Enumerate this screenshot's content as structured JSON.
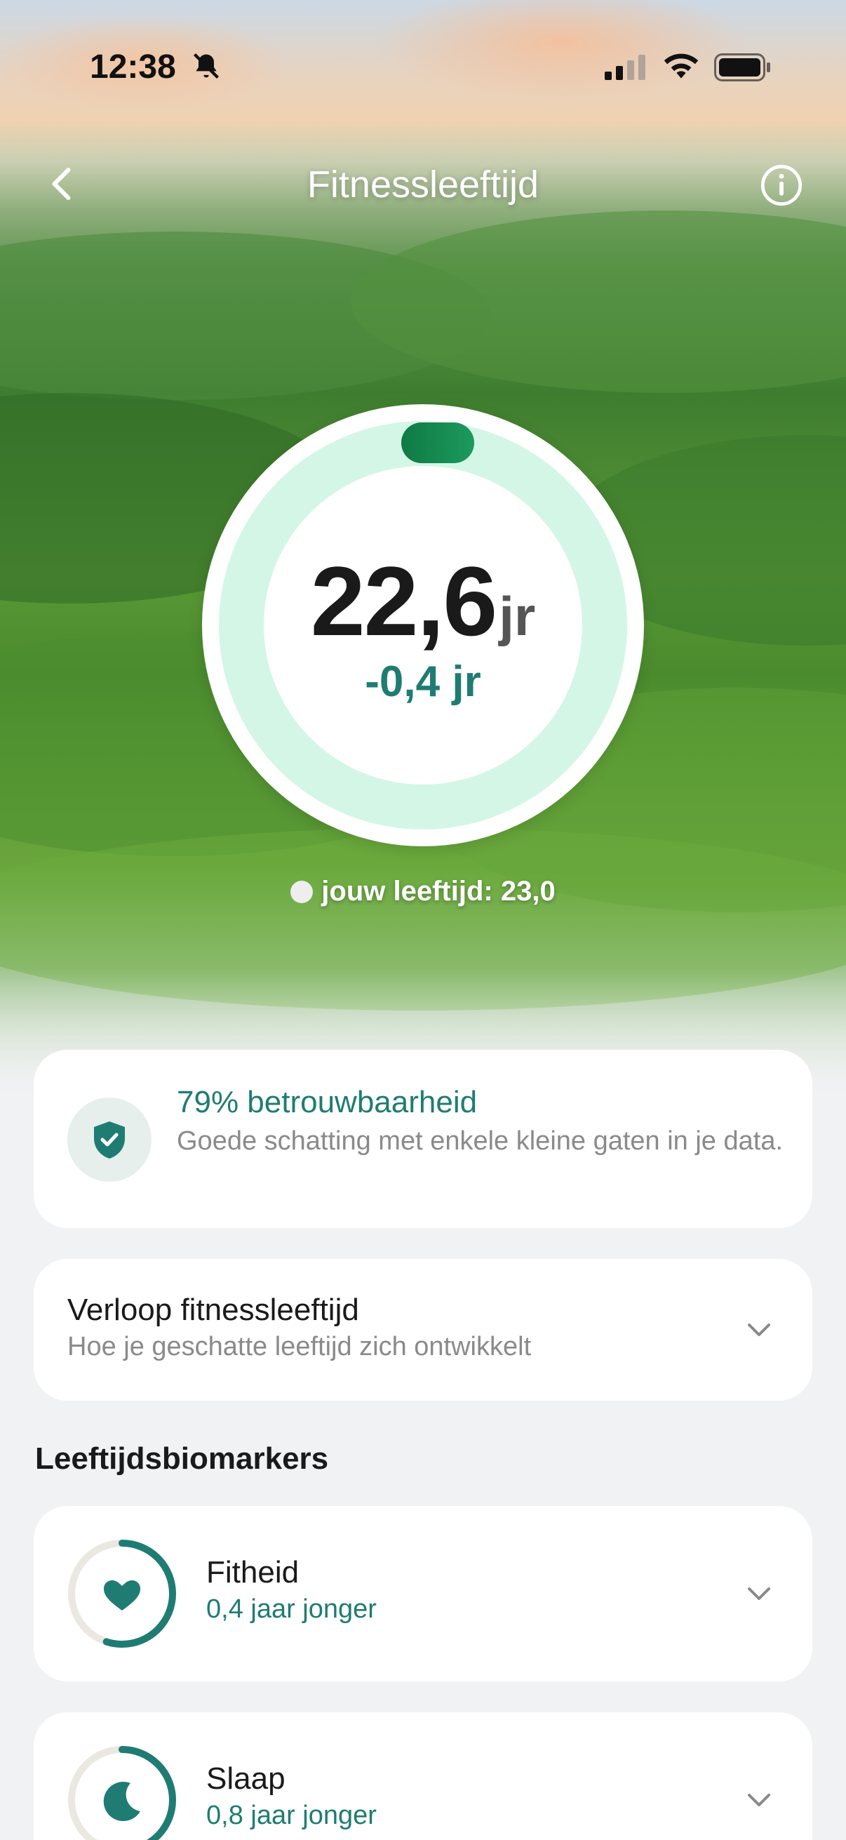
{
  "status_bar": {
    "time": "12:38",
    "icons": [
      "bell-slash-icon",
      "signal-icon",
      "wifi-icon",
      "battery-icon"
    ]
  },
  "nav": {
    "title": "Fitnessleeftijd",
    "back_icon": "chevron-left-icon",
    "info_icon": "info-icon"
  },
  "gauge": {
    "value": "22,6",
    "unit": "jr",
    "delta": "-0,4 jr"
  },
  "age_label": "jouw leeftijd: 23,0",
  "reliability": {
    "icon": "shield-check-icon",
    "title": "79% betrouwbaarheid",
    "description": "Goede schatting met enkele kleine gaten in je data."
  },
  "trend": {
    "title": "Verloop fitnessleeftijd",
    "subtitle": "Hoe je geschatte leeftijd zich ontwikkelt"
  },
  "biomarkers": {
    "section_title": "Leeftijdsbiomarkers",
    "items": [
      {
        "title": "Fitheid",
        "subtitle": "0,4 jaar jonger",
        "icon": "heart-icon",
        "progress": 0.55
      },
      {
        "title": "Slaap",
        "subtitle": "0,8 jaar jonger",
        "icon": "moon-icon",
        "progress": 0.5
      }
    ]
  },
  "colors": {
    "accent": "#1f7c73",
    "gauge_ring": "#d4f6e6",
    "gauge_knob": "#178a52",
    "muted_text": "#8a8a8a",
    "background": "#f1f2f4"
  }
}
